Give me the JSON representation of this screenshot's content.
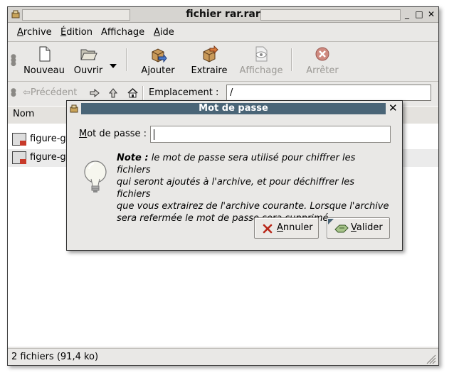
{
  "window": {
    "title": "fichier rar.rar",
    "controls": {
      "minimize": "_",
      "maximize": "□",
      "close": "✕"
    }
  },
  "menu": {
    "archive": {
      "first": "A",
      "rest": "rchive"
    },
    "edition": {
      "first": "É",
      "rest": "dition"
    },
    "affichage": {
      "before": "Afficha",
      "ul": "g",
      "after": "e"
    },
    "aide": {
      "first": "A",
      "rest": "ide"
    }
  },
  "toolbar": {
    "nouveau": "Nouveau",
    "ouvrir": "Ouvrir",
    "ajouter": "Ajouter",
    "extraire": "Extraire",
    "affichage": "Affichage",
    "arreter": "Arrêter"
  },
  "location": {
    "precedent": "Précédent",
    "label": "Emplacement :",
    "value": "/"
  },
  "list": {
    "column_name": "Nom",
    "rows": [
      {
        "name": "figure-ga"
      },
      {
        "name": "figure-ga"
      }
    ]
  },
  "status": {
    "text": "2 fichiers (91,4 ko)"
  },
  "dialog": {
    "title": "Mot de passe",
    "close": "✕",
    "field_label_first": "M",
    "field_label_rest": "ot de passe :",
    "password_value": "",
    "note_bold": "Note :",
    "note_line1": " le mot de passe sera utilisé pour chiffrer les fichiers",
    "note_line2": "qui seront ajoutés à l'archive, et pour déchiffrer les fichiers",
    "note_line3": "que vous extrairez de l'archive courante. Lorsque l'archive",
    "note_line4": "sera refermée le mot de passe sera supprimé.",
    "cancel": {
      "first": "A",
      "rest": "nnuler"
    },
    "ok": {
      "first": "V",
      "rest": "alider"
    }
  },
  "colors": {
    "dialog_titlebar": "#4a6577",
    "window_bg": "#e9e8e6",
    "stop_red": "#c83a2a"
  }
}
